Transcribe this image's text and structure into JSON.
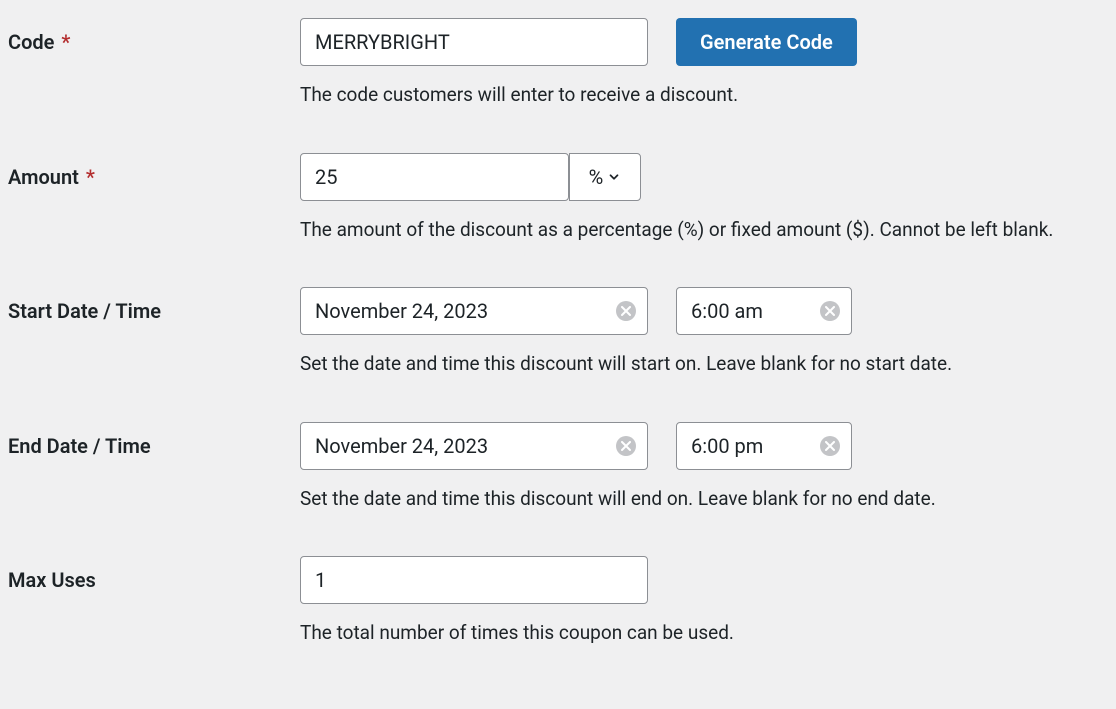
{
  "code": {
    "label": "Code",
    "value": "MERRYBRIGHT",
    "button": "Generate Code",
    "help": "The code customers will enter to receive a discount."
  },
  "amount": {
    "label": "Amount",
    "value": "25",
    "unit": "%",
    "help": "The amount of the discount as a percentage (%) or fixed amount ($). Cannot be left blank."
  },
  "start": {
    "label": "Start Date / Time",
    "date": "November 24, 2023",
    "time": "6:00 am",
    "help": "Set the date and time this discount will start on. Leave blank for no start date."
  },
  "end": {
    "label": "End Date / Time",
    "date": "November 24, 2023",
    "time": "6:00 pm",
    "help": "Set the date and time this discount will end on. Leave blank for no end date."
  },
  "max": {
    "label": "Max Uses",
    "value": "1",
    "help": "The total number of times this coupon can be used."
  }
}
